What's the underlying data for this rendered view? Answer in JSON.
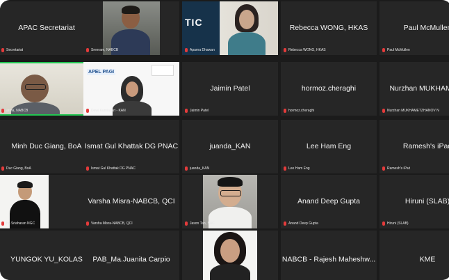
{
  "colors": {
    "background": "#1b1b1b",
    "tile": "#262626",
    "active_speaker_border": "#23c552",
    "muted_mic": "#e43b3b"
  },
  "rows": [
    [
      {
        "type": "name",
        "name": "APAC Secretariat",
        "caption": "Secretariat"
      },
      {
        "type": "video",
        "caption": "Sreeram, NABCB"
      },
      {
        "type": "video",
        "caption": "Aparna Dhawan"
      },
      {
        "type": "name",
        "name": "Rebecca WONG, HKAS",
        "caption": "Rebecca WONG, HKAS"
      },
      {
        "type": "name",
        "name": "Paul McMullen",
        "caption": "Paul McMullen"
      }
    ],
    [
      {
        "type": "video",
        "caption": "arma, NABCB",
        "speaking": true
      },
      {
        "type": "video",
        "caption": "Dewi Kurniasari - KAN",
        "banner": "APEL PAGI"
      },
      {
        "type": "name",
        "name": "Jaimin Patel",
        "caption": "Jaimin Patel"
      },
      {
        "type": "name",
        "name": "hormoz.cheraghi",
        "caption": "hormoz.cheraghi"
      },
      {
        "type": "name",
        "name": "Nurzhan MUKHAMETZ",
        "caption": "Nurzhan MUKHAMETZHANOV N"
      }
    ],
    [
      {
        "type": "name",
        "name": "Minh Duc Giang, BoA",
        "caption": "Duc Giang, BoA"
      },
      {
        "type": "name",
        "name": "Ismat Gul Khattak DG PNAC",
        "caption": "Ismat Gul Khattak DG PNAC"
      },
      {
        "type": "name",
        "name": "juanda_KAN",
        "caption": "juanda_KAN"
      },
      {
        "type": "name",
        "name": "Lee Ham Eng",
        "caption": "Lee Ham Eng"
      },
      {
        "type": "name",
        "name": "Ramesh's iPad",
        "caption": "Ramesh's iPad"
      }
    ],
    [
      {
        "type": "video",
        "caption": "ha Sriaharan NGC"
      },
      {
        "type": "name",
        "name": "Varsha Misra-NABCB, QCI",
        "caption": "Varsha Misra-NABCB, QCI"
      },
      {
        "type": "video",
        "caption": "Jason Tan, SAC"
      },
      {
        "type": "name",
        "name": "Anand Deep Gupta",
        "caption": "Anand Deep Gupta"
      },
      {
        "type": "name",
        "name": "Hiruni (SLAB)",
        "caption": "Hiruni (SLAB)"
      }
    ],
    [
      {
        "type": "name",
        "name": "YUNGOK YU_KOLAS",
        "caption": ""
      },
      {
        "type": "name",
        "name": "PAB_Ma.Juanita Carpio",
        "caption": ""
      },
      {
        "type": "video",
        "caption": ""
      },
      {
        "type": "name",
        "name": "NABCB - Rajesh Maheshw...",
        "caption": ""
      },
      {
        "type": "name",
        "name": "KME",
        "caption": ""
      }
    ]
  ],
  "logo_text": "TIC"
}
